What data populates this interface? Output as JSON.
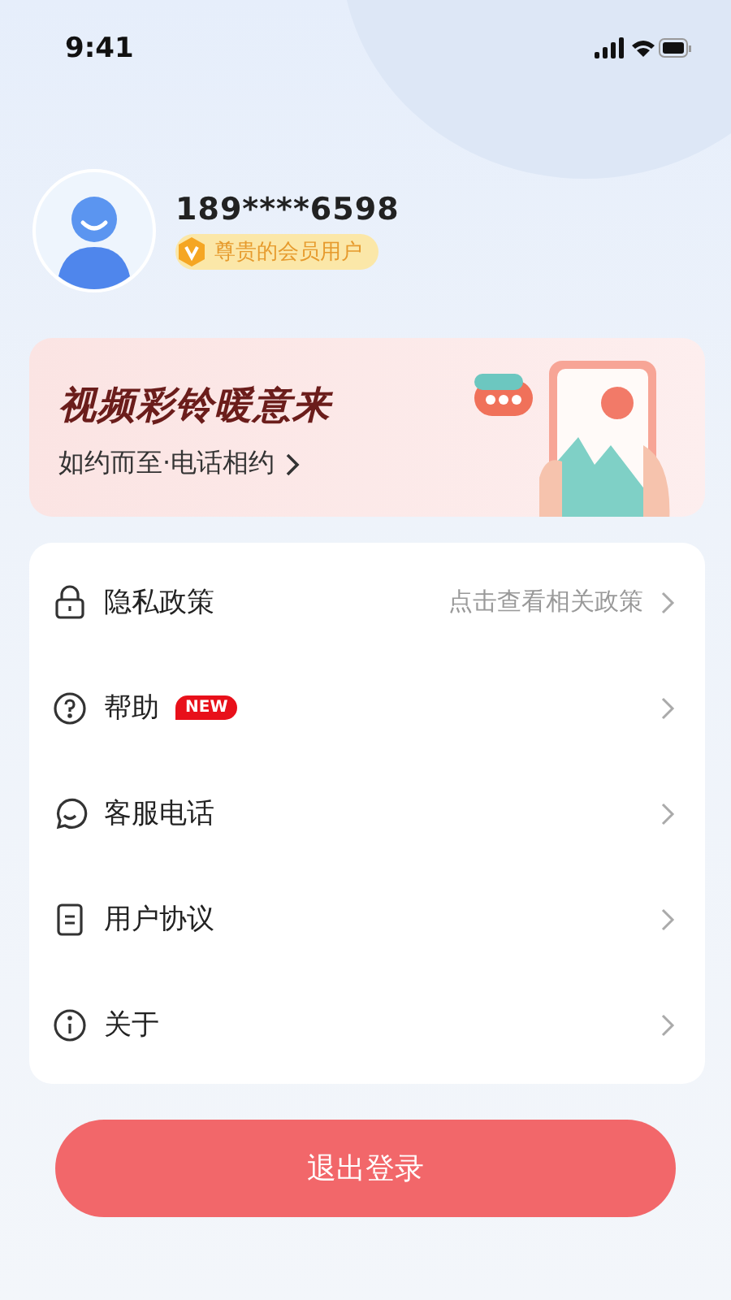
{
  "status_bar": {
    "time": "9:41"
  },
  "profile": {
    "phone": "189****6598",
    "member_badge": "尊贵的会员用户"
  },
  "banner": {
    "title": "视频彩铃暖意来",
    "subtitle": "如约而至·电话相约"
  },
  "menu": [
    {
      "label": "隐私政策",
      "detail": "点击查看相关政策"
    },
    {
      "label": "帮助",
      "badge": "NEW"
    },
    {
      "label": "客服电话"
    },
    {
      "label": "用户协议"
    },
    {
      "label": "关于"
    }
  ],
  "logout_button": "退出登录"
}
